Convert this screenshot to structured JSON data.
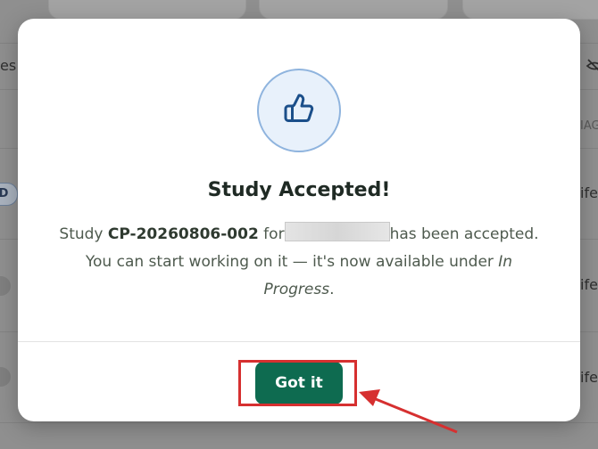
{
  "background": {
    "left_partial_text": "es",
    "pill_text": "D",
    "right_partial_texts": [
      "IAG",
      "ife",
      "ife",
      "ife"
    ]
  },
  "modal": {
    "icon": "thumbs-up-icon",
    "title": "Study Accepted!",
    "body": {
      "prefix": "Study ",
      "study_id": "CP-20260806-002",
      "for_text": " for",
      "after_redacted": "has been accepted. You can start working on it — it's now available under ",
      "status_link": "In Progress",
      "suffix": "."
    },
    "primary_button_label": "Got it"
  },
  "colors": {
    "button": "#0e6b50",
    "icon_stroke": "#1b4f8a",
    "icon_bg": "#e8f1fb",
    "annotation": "#d63030"
  }
}
